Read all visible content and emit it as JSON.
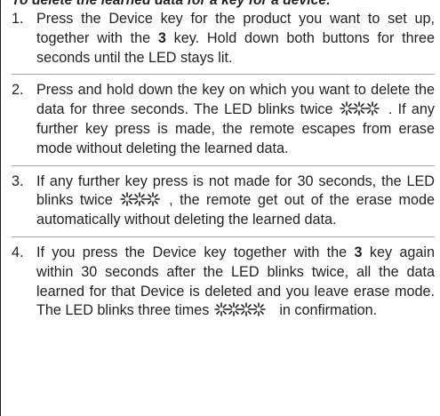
{
  "heading": "To delete the learned data for a key for a device:",
  "steps": [
    {
      "number": "1.",
      "text_a": "Press the Device key for the product you want to set up, together with the ",
      "bold_a": "3",
      "text_b": " key. Hold down both buttons for three seconds until the LED stays lit."
    },
    {
      "number": "2.",
      "text_a": "Press and hold down the key on which you want to delete the data for three seconds. The LED blinks twice ",
      "led_icon": "led-blink-twice-icon",
      "text_b": ". If any further key press is made, the remote escapes from erase mode without deleting the learned data."
    },
    {
      "number": "3.",
      "text_a": "If any further key press is not made for 30 seconds, the LED blinks twice ",
      "led_icon": "led-blink-twice-icon",
      "text_b": ", the remote get out of the erase mode automatically without deleting the learned data."
    },
    {
      "number": "4.",
      "text_a": "If you press the Device key together with the ",
      "bold_a": "3",
      "text_b": " key again within 30 seconds after the LED blinks twice, all the data learned for that Device is deleted and you leave erase mode. The LED blinks three times ",
      "led_icon": "led-blink-three-times-icon",
      "text_c": " in confirmation."
    }
  ]
}
